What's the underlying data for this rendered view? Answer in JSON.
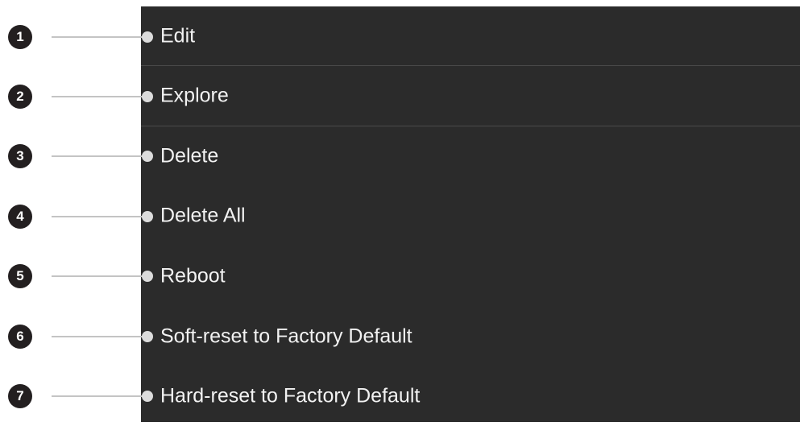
{
  "menu": {
    "items": [
      {
        "number": "1",
        "label": "Edit"
      },
      {
        "number": "2",
        "label": "Explore"
      },
      {
        "number": "3",
        "label": "Delete"
      },
      {
        "number": "4",
        "label": "Delete All"
      },
      {
        "number": "5",
        "label": "Reboot"
      },
      {
        "number": "6",
        "label": "Soft-reset to Factory Default"
      },
      {
        "number": "7",
        "label": "Hard-reset to Factory Default"
      }
    ]
  },
  "colors": {
    "panel_background": "#2b2b2b",
    "item_text": "#f2f2f2",
    "badge_background": "#231f20",
    "leader_line": "#c4c4c4"
  }
}
